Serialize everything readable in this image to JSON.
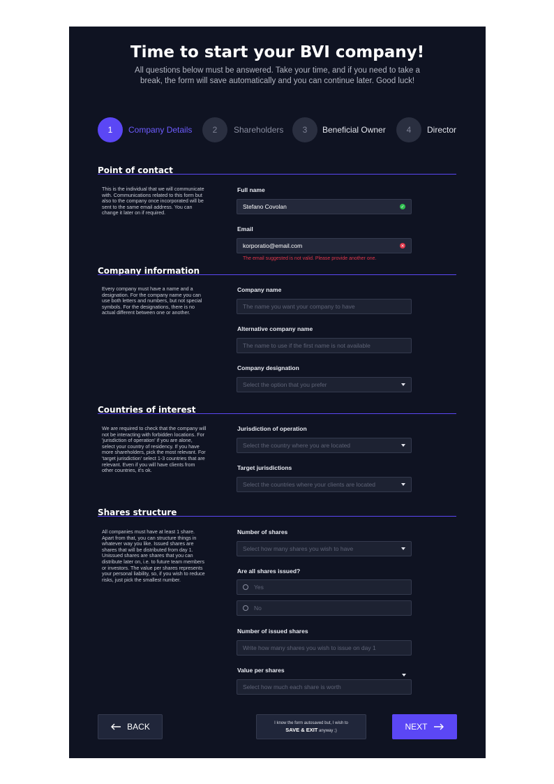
{
  "header": {
    "title": "Time to start your BVI company!",
    "subtitle": "All questions below must be answered. Take your time, and if you need to take a break, the form will save automatically and you can continue later. Good luck!"
  },
  "steps": [
    {
      "num": "1",
      "label": "Company Details"
    },
    {
      "num": "2",
      "label": "Shareholders"
    },
    {
      "num": "3",
      "label": "Beneficial Owner"
    },
    {
      "num": "4",
      "label": "Director"
    }
  ],
  "contact": {
    "title": "Point of contact",
    "desc": "This is the individual that we will communicate with. Communications related to this form but also to the company once incorporated will be sent to the same email address. You can change it later on if required.",
    "fullname_label": "Full name",
    "fullname_value": "Stefano Covolan",
    "email_label": "Email",
    "email_value": "korporatio@email.com",
    "email_error": "The email suggested is not valid. Please provide another one."
  },
  "company": {
    "title": "Company information",
    "desc": "Every company must have a name and a designation. For the company name you can use both letters and numbers, but not special symbols. For the designations, there is no actual different between one or another.",
    "name_label": "Company name",
    "name_placeholder": "The name you want your company to have",
    "alt_label": "Alternative company name",
    "alt_placeholder": "The name to use if the first name is not available",
    "designation_label": "Company designation",
    "designation_placeholder": "Select the option that you prefer"
  },
  "countries": {
    "title": "Countries of interest",
    "desc": "We are required to check that the company will not be interacting with forbidden locations. For 'jurisdiction of operation' if you are alone, select your country of residency. If you have more shareholders, pick the most relevant. For 'target jurisdiction' select 1-3 countries that are relevant. Even if you will have clients from other countries, it's ok.",
    "jurisdiction_label": "Jurisdiction of operation",
    "jurisdiction_placeholder": "Select the country where you are located",
    "target_label": "Target jurisdictions",
    "target_placeholder": "Select the countries where your clients are located"
  },
  "shares": {
    "title": "Shares structure",
    "desc": "All companies must have at least 1 share. Apart from that, you can structure things in whatever way you like. Issued shares are shares that will be distributed from day 1. Unissued shares are shares that you can distribute later on, i.e. to future team members or investors. The value per shares represents your personal liability, so, if you wish to reduce risks, just pick the smallest number.",
    "number_label": "Number of shares",
    "number_placeholder": "Select how many shares you wish to have",
    "issued_label": "Are all shares issued?",
    "yes": "Yes",
    "no": "No",
    "issued_count_label": "Number of issued shares",
    "issued_count_placeholder": "Write how many shares you wish to issue on day 1",
    "value_label": "Value per shares",
    "value_placeholder": "Select how much each share is worth"
  },
  "footer": {
    "back": "BACK",
    "save_line1": "I know the form autosaved but, I wish to",
    "save_bold": "SAVE & EXIT",
    "save_tail": "anyway ;)",
    "next": "NEXT"
  },
  "colors": {
    "accent": "#5b47f5",
    "background": "#0f1322",
    "success": "#2fbf4f",
    "error": "#e0364a"
  },
  "icons": [
    "check-icon",
    "error-icon",
    "chevron-down-icon",
    "radio-icon",
    "arrow-left-icon",
    "arrow-right-icon"
  ]
}
